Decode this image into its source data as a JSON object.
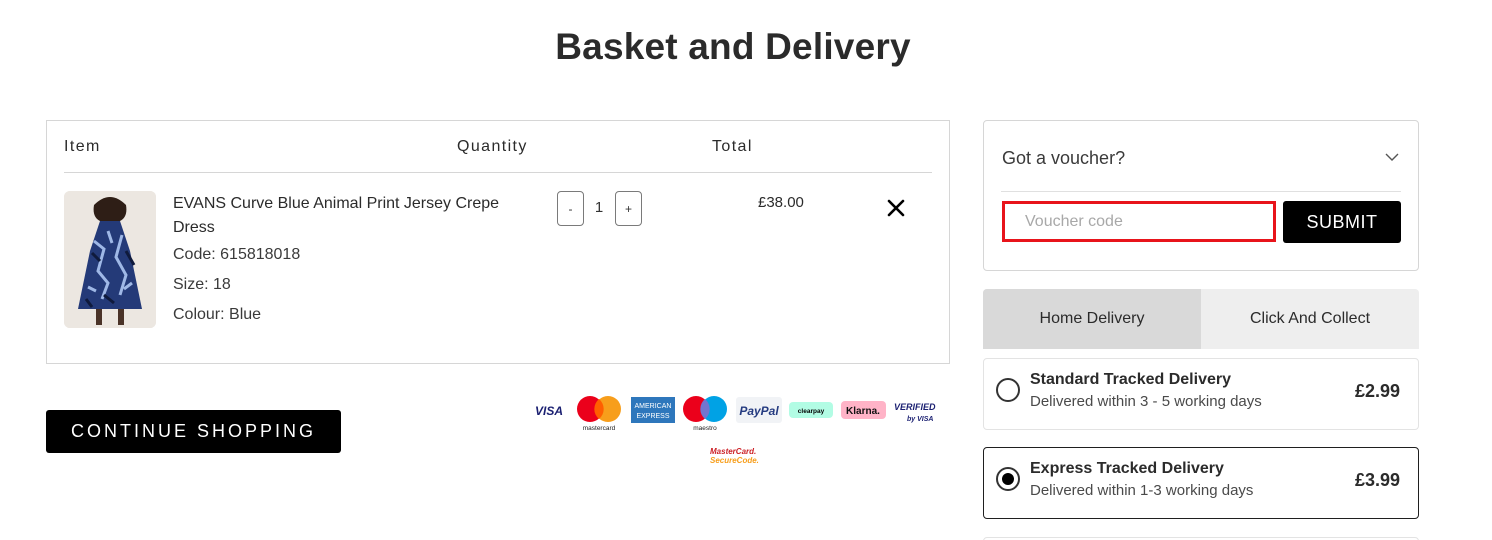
{
  "page": {
    "title": "Basket and Delivery"
  },
  "basket": {
    "headers": {
      "item": "Item",
      "quantity": "Quantity",
      "total": "Total"
    },
    "items": [
      {
        "name": "EVANS Curve Blue Animal Print Jersey Crepe Dress",
        "code": "Code: 615818018",
        "size": "Size: 18",
        "colour": "Colour: Blue",
        "quantity": "1",
        "minus_label": "-",
        "plus_label": "+",
        "total": "£38.00"
      }
    ],
    "continue_label": "CONTINUE SHOPPING"
  },
  "payments": {
    "visa": "VISA",
    "mastercard": "mastercard",
    "amex_line1": "AMERICAN",
    "amex_line2": "EXPRESS",
    "maestro": "maestro",
    "paypal": "PayPal",
    "clearpay": "clearpay",
    "klarna": "Klarna.",
    "verified_line1": "VERIFIED",
    "verified_line2": "by VISA",
    "securecode_line1": "MasterCard.",
    "securecode_line2": "SecureCode."
  },
  "voucher": {
    "title": "Got a voucher?",
    "placeholder": "Voucher code",
    "submit_label": "SUBMIT"
  },
  "delivery": {
    "tabs": [
      {
        "label": "Home Delivery",
        "active": true
      },
      {
        "label": "Click And Collect",
        "active": false
      }
    ],
    "options": [
      {
        "name": "Standard Tracked Delivery",
        "desc": "Delivered within 3 - 5 working days",
        "price": "£2.99",
        "selected": false
      },
      {
        "name": "Express Tracked Delivery",
        "desc": "Delivered within 1-3 working days",
        "price": "£3.99",
        "selected": true
      }
    ]
  },
  "colors": {
    "accent": "#000000",
    "focus_outline": "#e8141b",
    "tab_active": "#d9d9d9",
    "tab_inactive": "#eeeeee"
  }
}
